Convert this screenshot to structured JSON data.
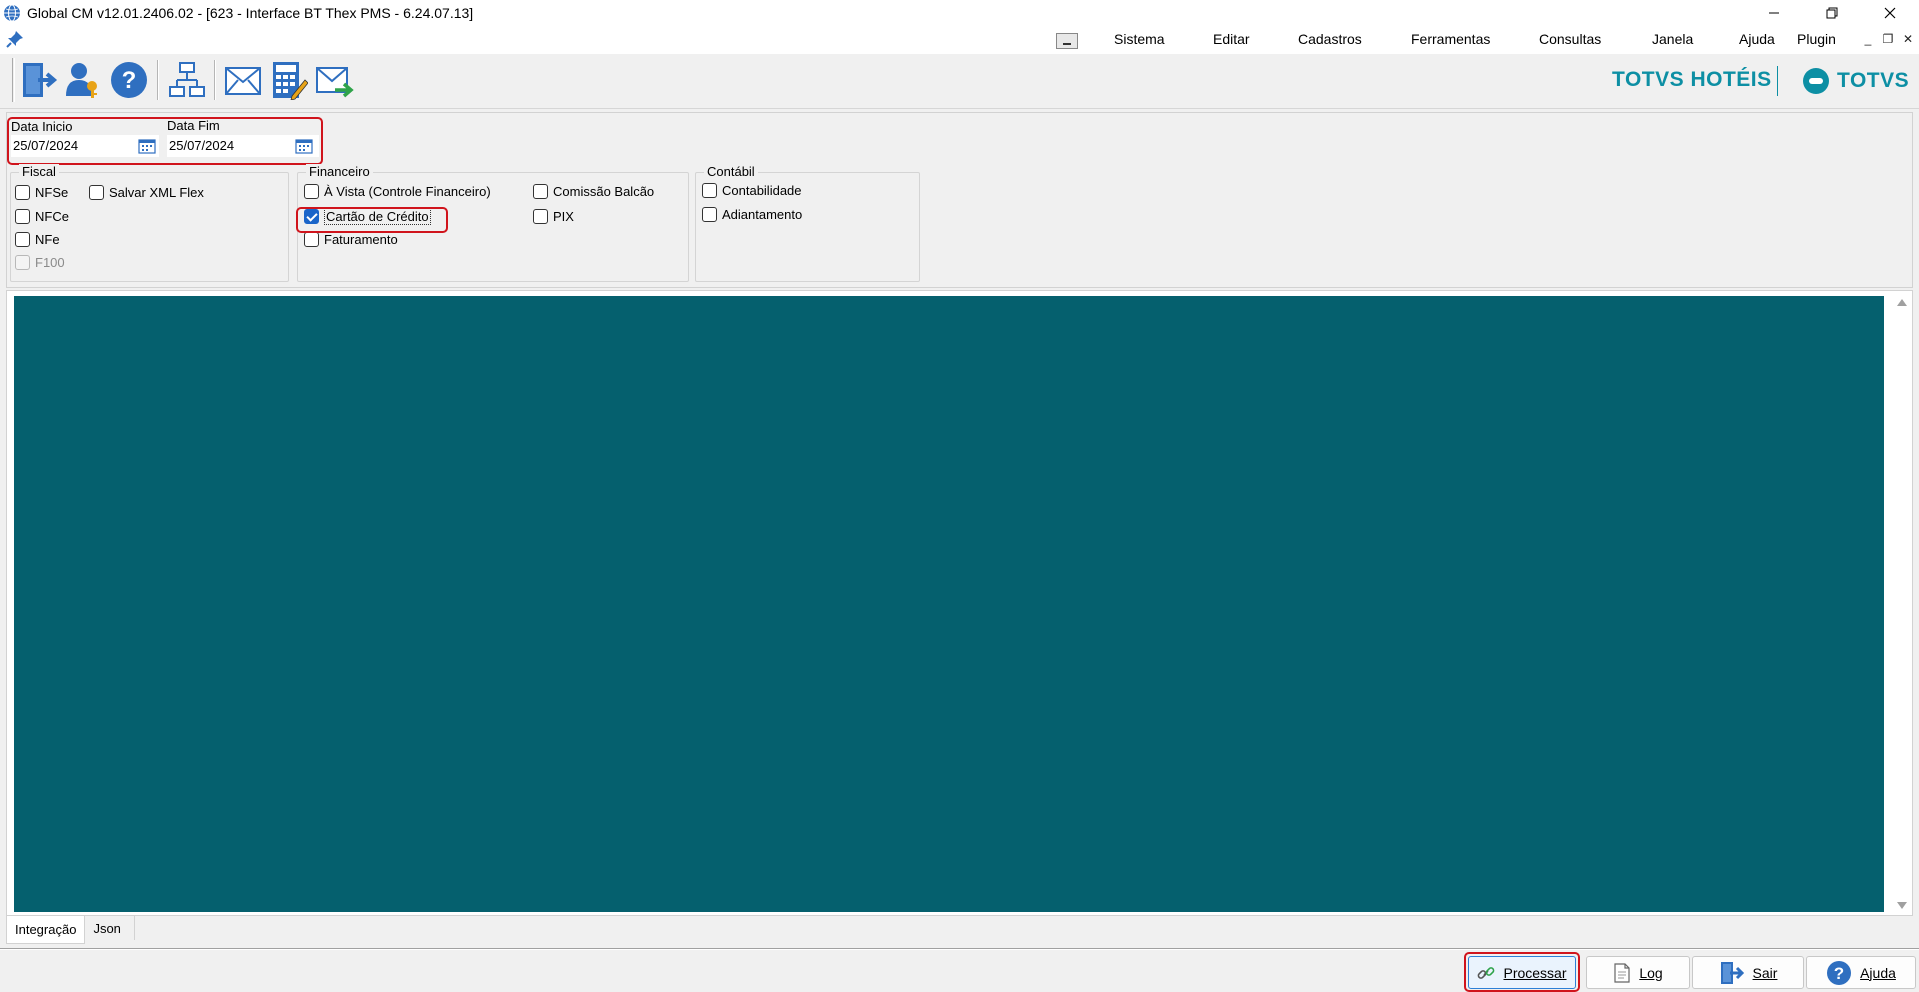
{
  "window": {
    "title": "Global CM v12.01.2406.02 - [623 - Interface BT Thex PMS - 6.24.07.13]"
  },
  "menu": {
    "items": [
      "Sistema",
      "Editar",
      "Cadastros",
      "Ferramentas",
      "Consultas",
      "Janela",
      "Ajuda",
      "Plugin"
    ]
  },
  "brand": {
    "hoteis": "TOTVS HOTÉIS",
    "totvs": "TOTVS"
  },
  "filters": {
    "data_inicio_label": "Data Inicio",
    "data_inicio_value": "25/07/2024",
    "data_fim_label": "Data Fim",
    "data_fim_value": "25/07/2024"
  },
  "fiscal": {
    "title": "Fiscal",
    "nfse": "NFSe",
    "nfce": "NFCe",
    "nfe": "NFe",
    "f100": "F100",
    "salvar_xml": "Salvar XML Flex"
  },
  "financeiro": {
    "title": "Financeiro",
    "a_vista": "À Vista (Controle Financeiro)",
    "cartao": "Cartão de Crédito",
    "faturamento": "Faturamento",
    "comissao": "Comissão Balcão",
    "pix": "PIX"
  },
  "contabil": {
    "title": "Contábil",
    "contabilidade": "Contabilidade",
    "adiantamento": "Adiantamento"
  },
  "tabs": {
    "integracao": "Integração",
    "json": "Json"
  },
  "buttons": {
    "processar": "Processar",
    "log": "Log",
    "sair": "Sair",
    "ajuda": "Ajuda"
  },
  "colors": {
    "panel": "#05606e",
    "brand": "#0d8fa4",
    "highlight": "#d0141c",
    "checked": "#1b65c9"
  }
}
